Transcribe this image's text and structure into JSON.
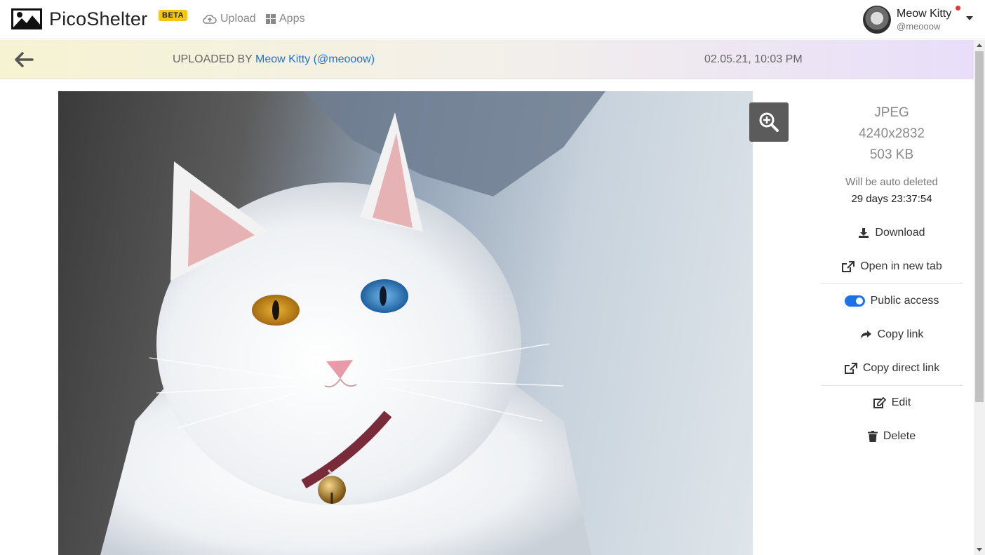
{
  "app": {
    "name": "PicoShelter",
    "badge": "BETA"
  },
  "nav": {
    "upload_label": "Upload",
    "apps_label": "Apps"
  },
  "user": {
    "name": "Meow Kitty",
    "handle": "@meooow"
  },
  "infobar": {
    "uploaded_by_prefix": "UPLOADED BY",
    "uploader_link": "Meow Kitty (@meooow)",
    "date": "02.05.21, 10:03 PM"
  },
  "image": {
    "format": "JPEG",
    "dimensions": "4240x2832",
    "size": "503 KB",
    "auto_delete_label": "Will be auto deleted",
    "countdown": "29 days 23:37:54"
  },
  "actions": {
    "download": "Download",
    "open_new_tab": "Open in new tab",
    "public_access": "Public access",
    "public_access_enabled": true,
    "copy_link": "Copy link",
    "copy_direct_link": "Copy direct link",
    "edit": "Edit",
    "delete": "Delete"
  },
  "colors": {
    "accent": "#1a73e8",
    "badge": "#f5c518"
  }
}
